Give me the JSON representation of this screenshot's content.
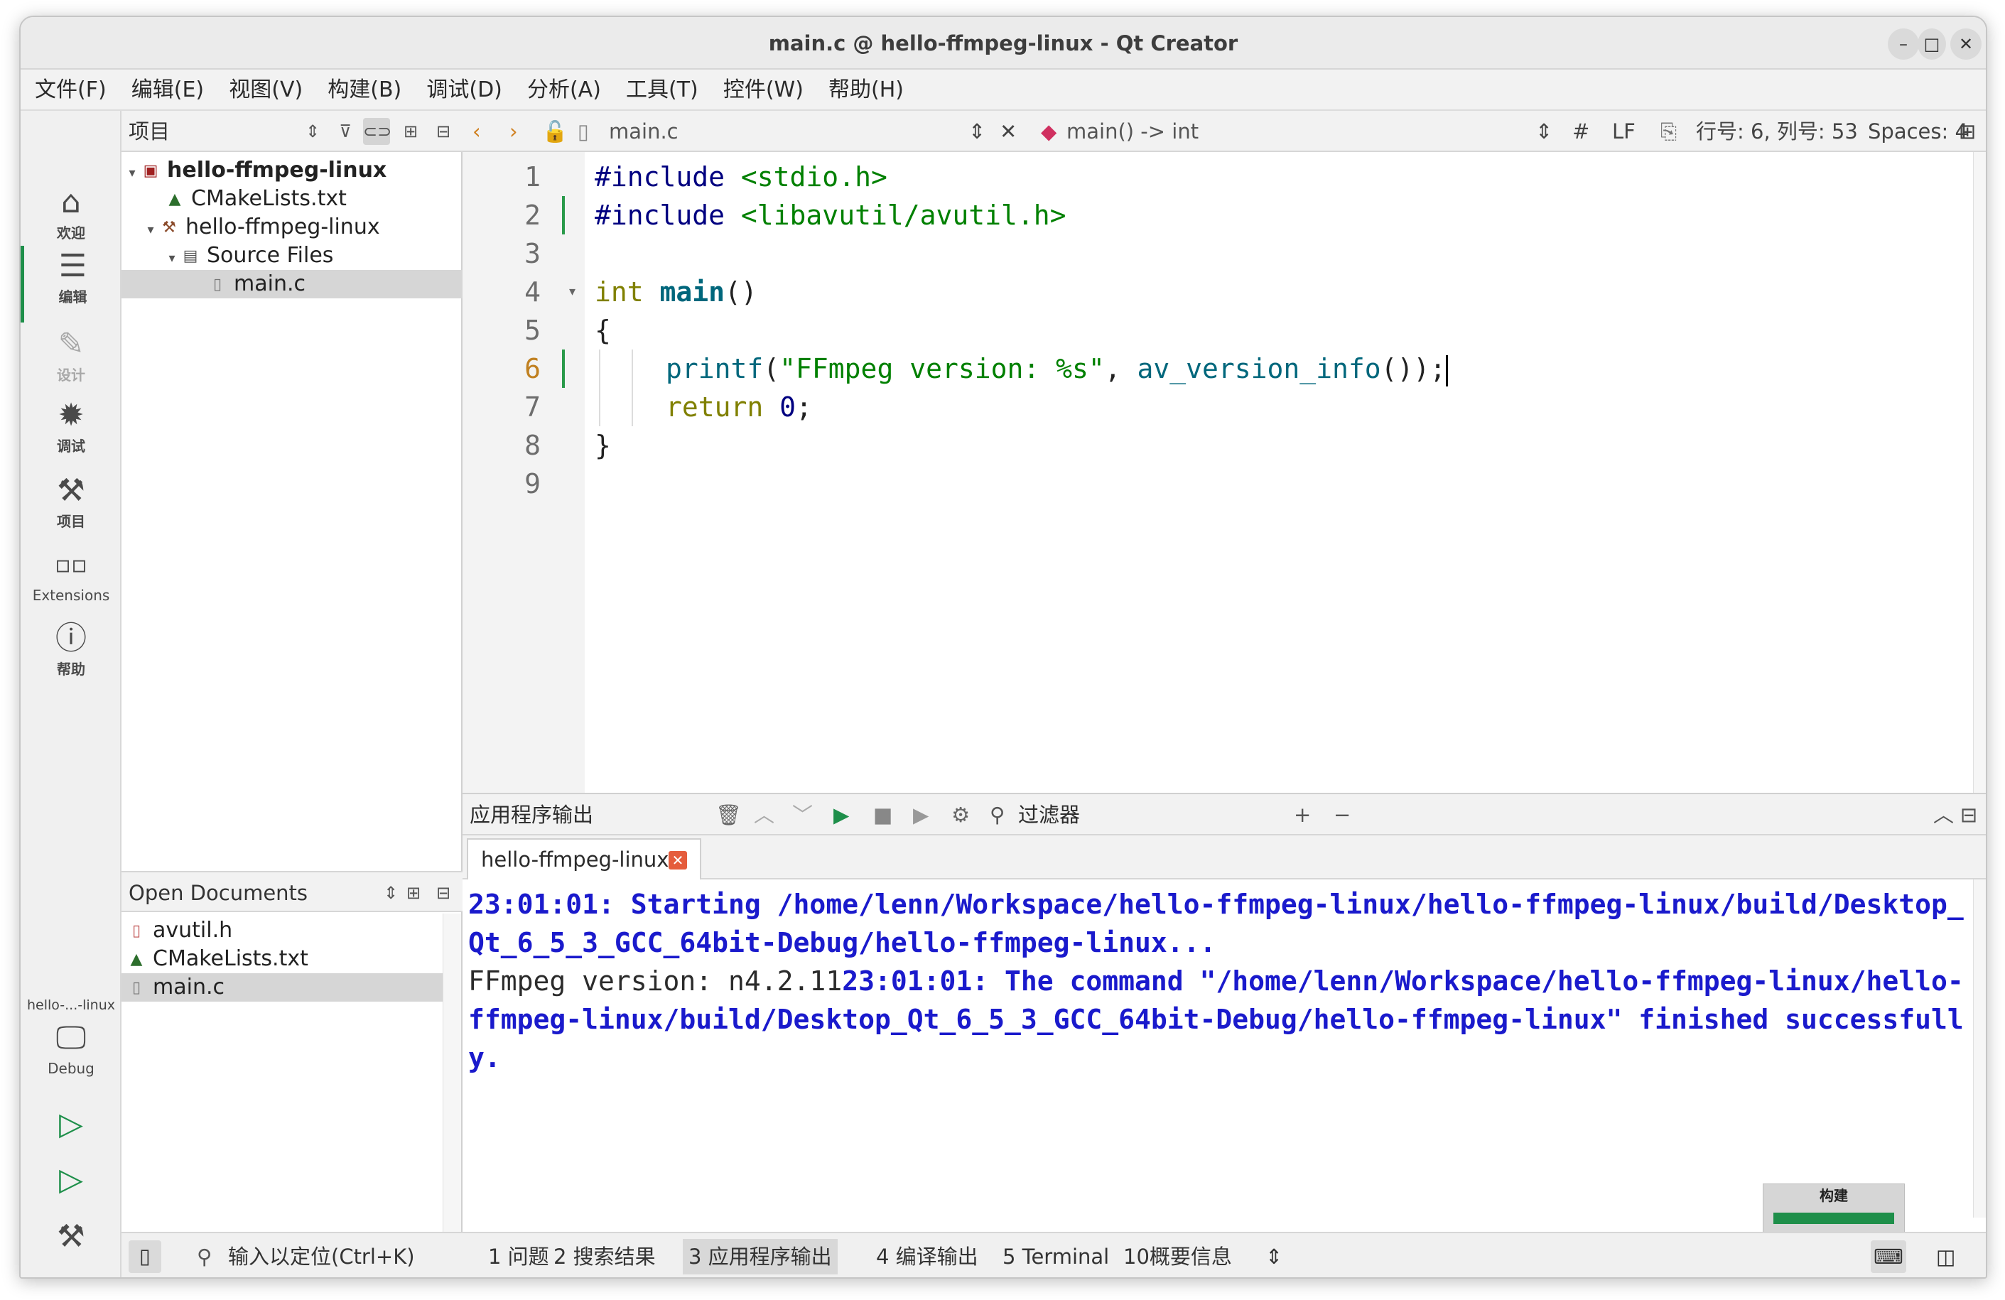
{
  "window": {
    "title": "main.c @ hello-ffmpeg-linux - Qt Creator",
    "minimize": "–",
    "maximize": "□",
    "close": "✕"
  },
  "menu": [
    "文件(F)",
    "编辑(E)",
    "视图(V)",
    "构建(B)",
    "调试(D)",
    "分析(A)",
    "工具(T)",
    "控件(W)",
    "帮助(H)"
  ],
  "modes": {
    "welcome": "欢迎",
    "edit": "编辑",
    "design": "设计",
    "debug": "调试",
    "projects": "项目",
    "extensions": "Extensions",
    "help": "帮助"
  },
  "kit": {
    "project": "hello-...-linux",
    "config": "Debug"
  },
  "project_panel": {
    "title": "项目",
    "tree": {
      "root": "hello-ffmpeg-linux",
      "cmake": "CMakeLists.txt",
      "target": "hello-ffmpeg-linux",
      "source_files": "Source Files",
      "main": "main.c"
    }
  },
  "open_documents": {
    "title": "Open Documents",
    "files": [
      "avutil.h",
      "CMakeLists.txt",
      "main.c"
    ]
  },
  "editor": {
    "file": "main.c",
    "symbol": "main() -> int",
    "hash": "#",
    "line_ending": "LF",
    "position": "行号: 6, 列号: 53",
    "indent": "Spaces: 4",
    "line_numbers": [
      "1",
      "2",
      "3",
      "4",
      "5",
      "6",
      "7",
      "8",
      "9"
    ],
    "code": {
      "l1_pp": "#include",
      "l1_inc": "<stdio.h>",
      "l2_pp": "#include",
      "l2_inc": "<libavutil/avutil.h>",
      "l4_kw": "int",
      "l4_fn": "main",
      "l4_rest": "()",
      "l5": "{",
      "l6_call": "printf",
      "l6_open": "(",
      "l6_str": "\"FFmpeg version: %s\"",
      "l6_mid": ", ",
      "l6_call2": "av_version_info",
      "l6_end": "());",
      "l7_kw": "return",
      "l7_num": "0",
      "l7_end": ";",
      "l8": "}"
    }
  },
  "output": {
    "title": "应用程序输出",
    "filter": "过滤器",
    "tab": "hello-ffmpeg-linux",
    "line_start": "23:01:01: Starting /home/lenn/Workspace/hello-ffmpeg-linux/hello-ffmpeg-linux/build/Desktop_Qt_6_5_3_GCC_64bit-Debug/hello-ffmpeg-linux...",
    "program_out": "FFmpeg version: n4.2.11",
    "line_finish": "23:01:01: The command \"/home/lenn/Workspace/hello-ffmpeg-linux/hello-ffmpeg-linux/build/Desktop_Qt_6_5_3_GCC_64bit-Debug/hello-ffmpeg-linux\" finished successfully."
  },
  "build_progress": {
    "label": "构建",
    "fraction": 1.0
  },
  "status": {
    "locator": "输入以定位(Ctrl+K)",
    "panes": [
      "1 问题",
      "2 搜索结果",
      "3 应用程序输出",
      "4 编译输出",
      "5 Terminal",
      "10概要信息"
    ]
  },
  "colors": {
    "accent": "#1e8f4a",
    "output_blue": "#1a1acc"
  }
}
